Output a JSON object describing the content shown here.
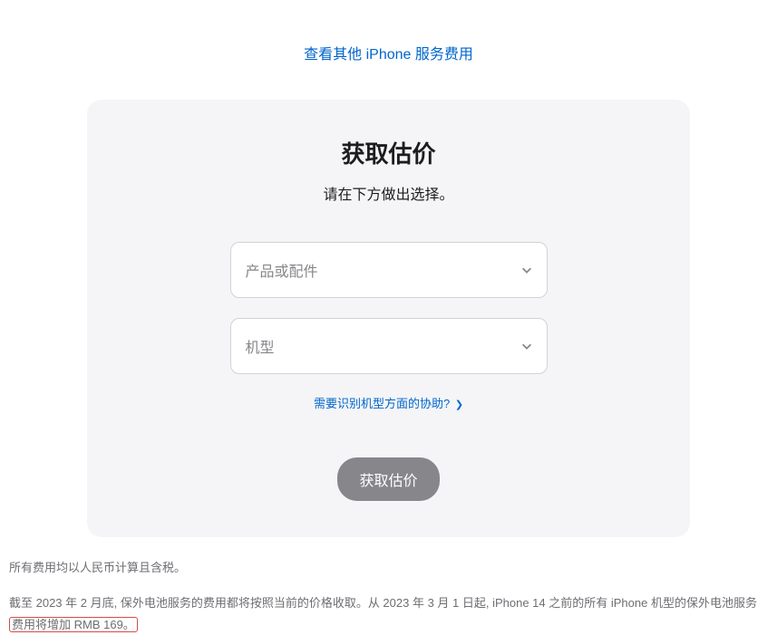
{
  "topLink": "查看其他 iPhone 服务费用",
  "card": {
    "title": "获取估价",
    "subtitle": "请在下方做出选择。",
    "select1": "产品或配件",
    "select2": "机型",
    "helpLink": "需要识别机型方面的协助?",
    "button": "获取估价"
  },
  "footnote1": "所有费用均以人民币计算且含税。",
  "footnote2_a": "截至 2023 年 2 月底, 保外电池服务的费用都将按照当前的价格收取。从 2023 年 3 月 1 日起, iPhone 14 之前的所有 iPhone 机型的保外电池服务",
  "footnote2_b": "费用将增加 RMB 169。"
}
